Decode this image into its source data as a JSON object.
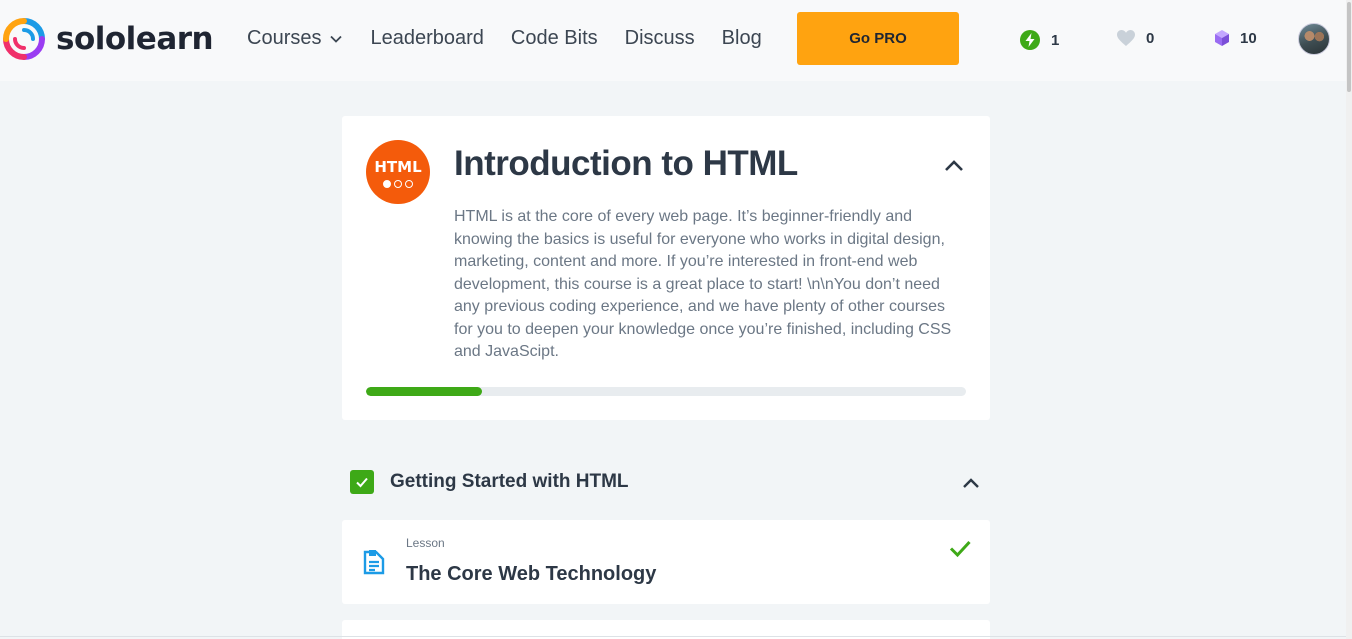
{
  "header": {
    "logo_text": "sololearn",
    "nav": {
      "courses": "Courses",
      "leaderboard": "Leaderboard",
      "code_bits": "Code Bits",
      "discuss": "Discuss",
      "blog": "Blog"
    },
    "go_pro_label": "Go PRO",
    "stats": {
      "streak": "1",
      "hearts": "0",
      "bits": "10"
    },
    "icons": [
      "logo-icon",
      "chevron-down-icon",
      "lightning-icon",
      "heart-icon",
      "cube-icon",
      "avatar"
    ]
  },
  "course": {
    "icon_label": "HTML",
    "title": "Introduction to HTML",
    "description": "HTML is at the core of every web page. It’s beginner-friendly and knowing the basics is useful for everyone who works in digital design, marketing, content and more. If you’re interested in front-end web development, this course is a great place to start! \\n\\nYou don’t need any previous coding experience, and we have plenty of other courses for you to deepen your knowledge once you’re finished, including CSS and JavaScipt.",
    "progress_fraction": 0.193
  },
  "module": {
    "title": "Getting Started with HTML",
    "completed": true
  },
  "lessons": [
    {
      "type": "Lesson",
      "title": "The Core Web Technology",
      "completed": true
    }
  ],
  "colors": {
    "accent_orange": "#ffa310",
    "html_icon": "#f45b0b",
    "success_green": "#3ea917",
    "lesson_icon_blue": "#1c9be6",
    "bits_purple": "#9a6cf2"
  }
}
